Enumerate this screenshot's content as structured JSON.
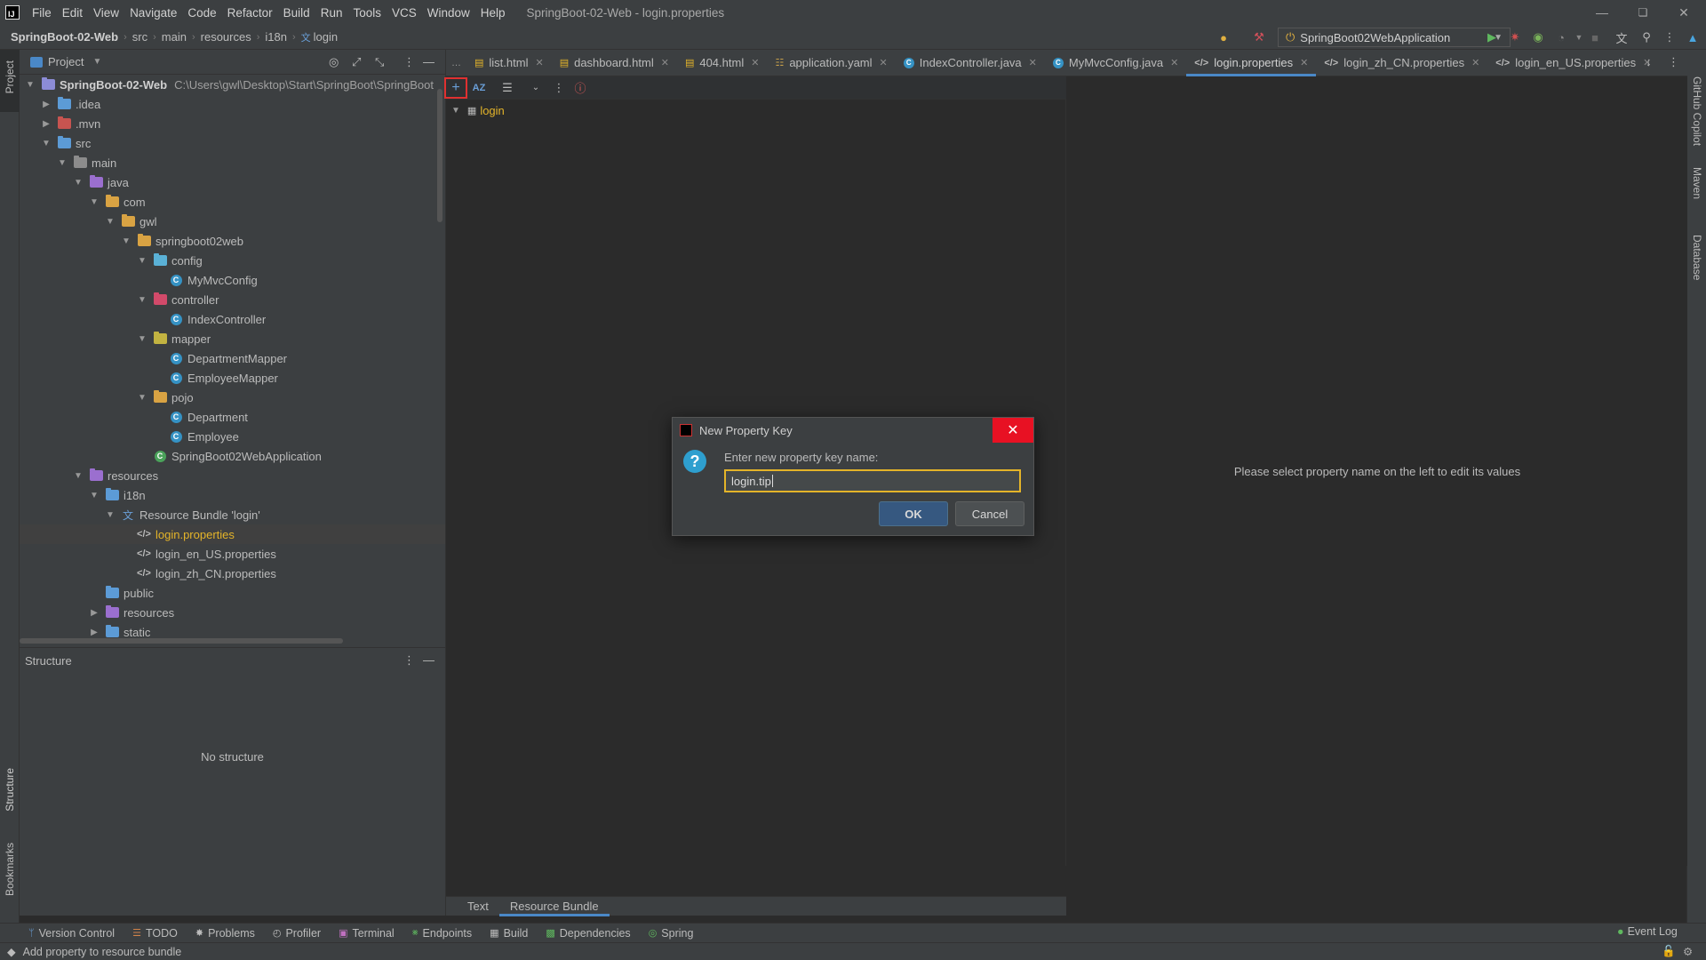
{
  "menubar": {
    "items": [
      "File",
      "Edit",
      "View",
      "Navigate",
      "Code",
      "Refactor",
      "Build",
      "Run",
      "Tools",
      "VCS",
      "Window",
      "Help"
    ],
    "window_title": "SpringBoot-02-Web - login.properties"
  },
  "navbar": {
    "crumbs": [
      "SpringBoot-02-Web",
      "src",
      "main",
      "resources",
      "i18n",
      "login"
    ],
    "run_config": "SpringBoot02WebApplication"
  },
  "left_stripe": {
    "project": "Project",
    "structure": "Structure",
    "bookmarks": "Bookmarks"
  },
  "right_stripe": {
    "copilot": "GitHub Copilot",
    "maven": "Maven",
    "database": "Database"
  },
  "project_panel": {
    "title": "Project",
    "root_path": "C:\\Users\\gwl\\Desktop\\Start\\SpringBoot\\SpringBoot",
    "tree": [
      {
        "label": "SpringBoot-02-Web",
        "depth": 0,
        "arrow": "down",
        "icon": "module",
        "bold": true
      },
      {
        "label": ".idea",
        "depth": 1,
        "arrow": "right",
        "icon": "folder-blue"
      },
      {
        "label": ".mvn",
        "depth": 1,
        "arrow": "right",
        "icon": "folder-red"
      },
      {
        "label": "src",
        "depth": 1,
        "arrow": "down",
        "icon": "folder-src"
      },
      {
        "label": "main",
        "depth": 2,
        "arrow": "down",
        "icon": "folder-gray"
      },
      {
        "label": "java",
        "depth": 3,
        "arrow": "down",
        "icon": "folder-purple"
      },
      {
        "label": "com",
        "depth": 4,
        "arrow": "down",
        "icon": "folder-yellow"
      },
      {
        "label": "gwl",
        "depth": 5,
        "arrow": "down",
        "icon": "folder-yellow"
      },
      {
        "label": "springboot02web",
        "depth": 6,
        "arrow": "down",
        "icon": "folder-yellow"
      },
      {
        "label": "config",
        "depth": 7,
        "arrow": "down",
        "icon": "folder-config"
      },
      {
        "label": "MyMvcConfig",
        "depth": 8,
        "arrow": "",
        "icon": "class"
      },
      {
        "label": "controller",
        "depth": 7,
        "arrow": "down",
        "icon": "folder-controller"
      },
      {
        "label": "IndexController",
        "depth": 8,
        "arrow": "",
        "icon": "class"
      },
      {
        "label": "mapper",
        "depth": 7,
        "arrow": "down",
        "icon": "folder-mapper"
      },
      {
        "label": "DepartmentMapper",
        "depth": 8,
        "arrow": "",
        "icon": "class"
      },
      {
        "label": "EmployeeMapper",
        "depth": 8,
        "arrow": "",
        "icon": "class"
      },
      {
        "label": "pojo",
        "depth": 7,
        "arrow": "down",
        "icon": "folder-yellow"
      },
      {
        "label": "Department",
        "depth": 8,
        "arrow": "",
        "icon": "class"
      },
      {
        "label": "Employee",
        "depth": 8,
        "arrow": "",
        "icon": "class"
      },
      {
        "label": "SpringBoot02WebApplication",
        "depth": 7,
        "arrow": "",
        "icon": "spring-class"
      },
      {
        "label": "resources",
        "depth": 3,
        "arrow": "down",
        "icon": "folder-purple"
      },
      {
        "label": "i18n",
        "depth": 4,
        "arrow": "down",
        "icon": "folder-blue"
      },
      {
        "label": "Resource Bundle 'login'",
        "depth": 5,
        "arrow": "down",
        "icon": "bundle"
      },
      {
        "label": "login.properties",
        "depth": 6,
        "arrow": "",
        "icon": "props",
        "selected": true
      },
      {
        "label": "login_en_US.properties",
        "depth": 6,
        "arrow": "",
        "icon": "props"
      },
      {
        "label": "login_zh_CN.properties",
        "depth": 6,
        "arrow": "",
        "icon": "props"
      },
      {
        "label": "public",
        "depth": 4,
        "arrow": "",
        "icon": "folder-blue"
      },
      {
        "label": "resources",
        "depth": 4,
        "arrow": "right",
        "icon": "folder-purple"
      },
      {
        "label": "static",
        "depth": 4,
        "arrow": "right",
        "icon": "folder-blue"
      }
    ]
  },
  "structure_panel": {
    "title": "Structure",
    "empty": "No structure"
  },
  "editor": {
    "tabs": [
      {
        "label": "list.html",
        "icon": "html"
      },
      {
        "label": "dashboard.html",
        "icon": "html"
      },
      {
        "label": "404.html",
        "icon": "html"
      },
      {
        "label": "application.yaml",
        "icon": "yaml"
      },
      {
        "label": "IndexController.java",
        "icon": "java"
      },
      {
        "label": "MyMvcConfig.java",
        "icon": "java"
      },
      {
        "label": "login.properties",
        "icon": "props",
        "active": true
      },
      {
        "label": "login_zh_CN.properties",
        "icon": "props"
      },
      {
        "label": "login_en_US.properties",
        "icon": "props"
      }
    ],
    "bundle_node": "login",
    "right_hint": "Please select property name on the left to edit its values",
    "bottom_tabs": [
      {
        "label": "Text"
      },
      {
        "label": "Resource Bundle",
        "active": true
      }
    ]
  },
  "dialog": {
    "title": "New Property Key",
    "prompt": "Enter new property key name:",
    "value": "login.tip",
    "ok": "OK",
    "cancel": "Cancel"
  },
  "tool_windows": [
    {
      "label": "Version Control",
      "icon": "vcs-icon"
    },
    {
      "label": "TODO",
      "icon": "todo-icon"
    },
    {
      "label": "Problems",
      "icon": "problems-icon"
    },
    {
      "label": "Profiler",
      "icon": "profiler-icon"
    },
    {
      "label": "Terminal",
      "icon": "terminal-icon"
    },
    {
      "label": "Endpoints",
      "icon": "endpoints-icon"
    },
    {
      "label": "Build",
      "icon": "build-icon"
    },
    {
      "label": "Dependencies",
      "icon": "dependencies-icon"
    },
    {
      "label": "Spring",
      "icon": "spring-icon"
    }
  ],
  "event_log": "Event Log",
  "status": "Add property to resource bundle",
  "colors": {
    "accent": "#4a88c7",
    "highlight": "#e4b429",
    "close_red": "#e81123",
    "selected_file": "#e4b429"
  }
}
